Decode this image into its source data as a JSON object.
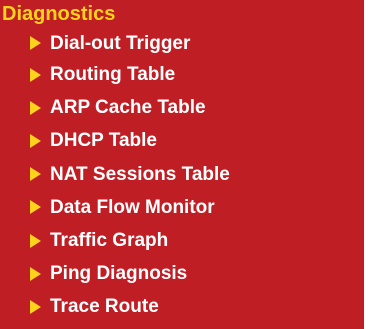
{
  "menu": {
    "header": "Diagnostics",
    "colors": {
      "background": "#bf1e24",
      "header_text": "#ffd21c",
      "item_text": "#ffffff",
      "arrow": "#ffd21c"
    },
    "items": [
      {
        "label": "Dial-out Trigger",
        "icon": "triangle-right-icon"
      },
      {
        "label": "Routing Table",
        "icon": "triangle-right-icon"
      },
      {
        "label": "ARP Cache Table",
        "icon": "triangle-right-icon"
      },
      {
        "label": "DHCP Table",
        "icon": "triangle-right-icon"
      },
      {
        "label": "NAT Sessions Table",
        "icon": "triangle-right-icon"
      },
      {
        "label": "Data Flow Monitor",
        "icon": "triangle-right-icon"
      },
      {
        "label": "Traffic Graph",
        "icon": "triangle-right-icon"
      },
      {
        "label": "Ping Diagnosis",
        "icon": "triangle-right-icon"
      },
      {
        "label": "Trace Route",
        "icon": "triangle-right-icon"
      }
    ]
  }
}
